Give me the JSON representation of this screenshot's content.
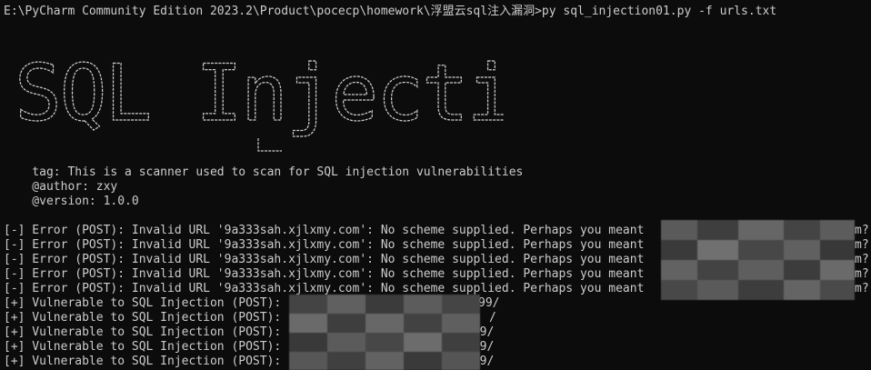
{
  "terminal": {
    "command_line": "E:\\PyCharm Community Edition 2023.2\\Product\\pocecp\\homework\\浮盟云sql注入漏洞>py sql_injection01.py -f urls.txt",
    "banner_text": "SQL Injection",
    "tag_line": "    tag: This is a scanner used to scan for SQL injection vulnerabilities",
    "author_line": "    @author: zxy",
    "version_line": "    @version: 1.0.0",
    "error_lines": [
      "[-] Error (POST): Invalid URL '9a333sah.xjlxmy.com': No scheme supplied. Perhaps you meant",
      "[-] Error (POST): Invalid URL '9a333sah.xjlxmy.com': No scheme supplied. Perhaps you meant",
      "[-] Error (POST): Invalid URL '9a333sah.xjlxmy.com': No scheme supplied. Perhaps you meant",
      "[-] Error (POST): Invalid URL '9a333sah.xjlxmy.com': No scheme supplied. Perhaps you meant",
      "[-] Error (POST): Invalid URL '9a333sah.xjlxmy.com': No scheme supplied. Perhaps you meant"
    ],
    "error_tails": [
      "m?",
      "m?",
      "m?",
      "m?",
      "m?"
    ],
    "vuln_lines": [
      "[+] Vulnerable to SQL Injection (POST):",
      "[+] Vulnerable to SQL Injection (POST):",
      "[+] Vulnerable to SQL Injection (POST):",
      "[+] Vulnerable to SQL Injection (POST):",
      "[+] Vulnerable to SQL Injection (POST):"
    ],
    "vuln_tails": [
      "99/",
      "/",
      ":99/",
      ":99/",
      ":99/"
    ]
  }
}
